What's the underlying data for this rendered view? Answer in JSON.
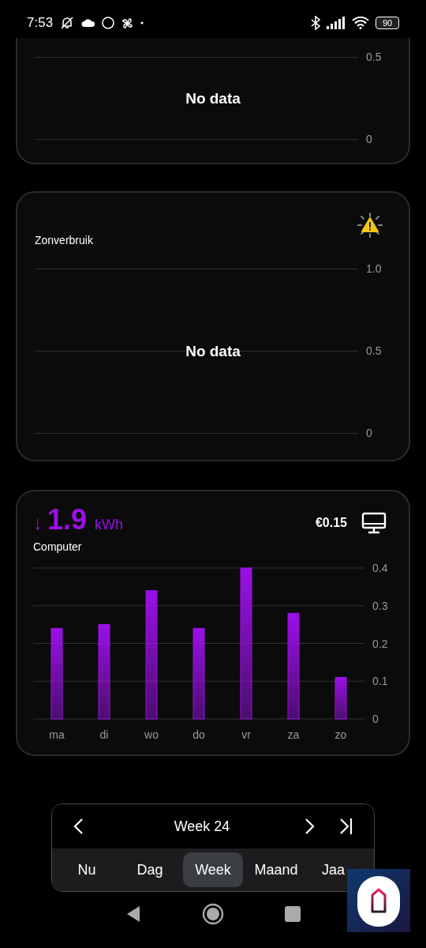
{
  "status_bar": {
    "time": "7:53",
    "battery": "90"
  },
  "cards": [
    {
      "kind": "empty",
      "message": "No data",
      "y_labels": [
        "0.5",
        "0"
      ],
      "cut_top": true
    },
    {
      "kind": "empty",
      "title": "Zonverbruik",
      "message": "No data",
      "y_labels": [
        "1.0",
        "0.5",
        "0"
      ],
      "cut_top": false,
      "warning": true
    },
    {
      "kind": "bars",
      "arrow": "↓",
      "value": "1.9",
      "unit": "kWh",
      "cost": "€0.15",
      "chart_data": {
        "type": "bar",
        "categories": [
          "ma",
          "di",
          "wo",
          "do",
          "vr",
          "za",
          "zo"
        ],
        "series": [
          {
            "name": "Computer",
            "color": "#9b10e8",
            "values": [
              0.24,
              0.25,
              0.34,
              0.24,
              0.4,
              0.28,
              0.11
            ]
          }
        ],
        "ylim": [
          0,
          0.4
        ],
        "yticks": [
          0.4,
          0.3,
          0.2,
          0.1,
          0
        ],
        "grid": true
      }
    }
  ],
  "period": {
    "label": "Week 24",
    "tabs": [
      {
        "label": "Nu",
        "selected": false
      },
      {
        "label": "Dag",
        "selected": false
      },
      {
        "label": "Week",
        "selected": true
      },
      {
        "label": "Maand",
        "selected": false
      },
      {
        "label": "Jaa",
        "selected": false
      }
    ]
  }
}
